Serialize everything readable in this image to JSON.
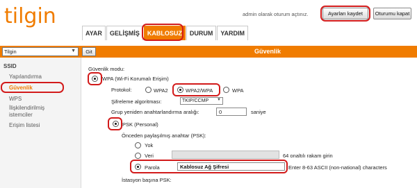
{
  "header": {
    "logo": "tilgin",
    "logged_in_text": "admin olarak oturum açtınız.",
    "save_label": "Ayarları kaydet",
    "logout_label": "Oturumu kapat"
  },
  "tabs": [
    {
      "label": "AYAR"
    },
    {
      "label": "GELİŞMİŞ"
    },
    {
      "label": "KABLOSUZ",
      "active": true
    },
    {
      "label": "DURUM"
    },
    {
      "label": "YARDIM"
    }
  ],
  "bar": {
    "device_select": "Tilgin",
    "go_label": "Git",
    "title": "Güvenlik"
  },
  "sidebar": {
    "heading": "SSID",
    "items": [
      {
        "label": "Yapılandırma"
      },
      {
        "label": "Güvenlik",
        "active": true
      },
      {
        "label": "WPS"
      },
      {
        "label": "İlişkilendirilmiş"
      },
      {
        "label": "istemciler"
      },
      {
        "label": "Erişim listesi"
      }
    ]
  },
  "content": {
    "security_mode_label": "Güvenlik modu:",
    "wpa_option": "WPA (Wi-Fi Korumalı Erişim)",
    "protocol_label": "Protokol:",
    "protocol_wpa2": "WPA2",
    "protocol_wpa2wpa": "WPA2/WPA",
    "protocol_wpa": "WPA",
    "encryption_label": "Şifreleme algoritması:",
    "encryption_value": "TKIP/CCMP",
    "rekey_label": "Grup yeniden anahtarlandırma aralığı:",
    "rekey_value": "0",
    "rekey_unit": "saniye",
    "psk_option": "PSK (Personal)",
    "preshared_label": "Önceden paylaşılmış anahtar (PSK):",
    "opt_none": "Yok",
    "opt_data": "Veri",
    "data_hint": "64 onaltılı rakam girin",
    "opt_password": "Parola",
    "password_value": "Kablosuz Ağ Şifresi",
    "password_hint": "Enter 8-63 ASCII (non-national) characters",
    "per_station_psk": "İstasyon başına PSK:"
  },
  "colors": {
    "accent": "#f07c00",
    "highlight": "#d21a1a"
  }
}
